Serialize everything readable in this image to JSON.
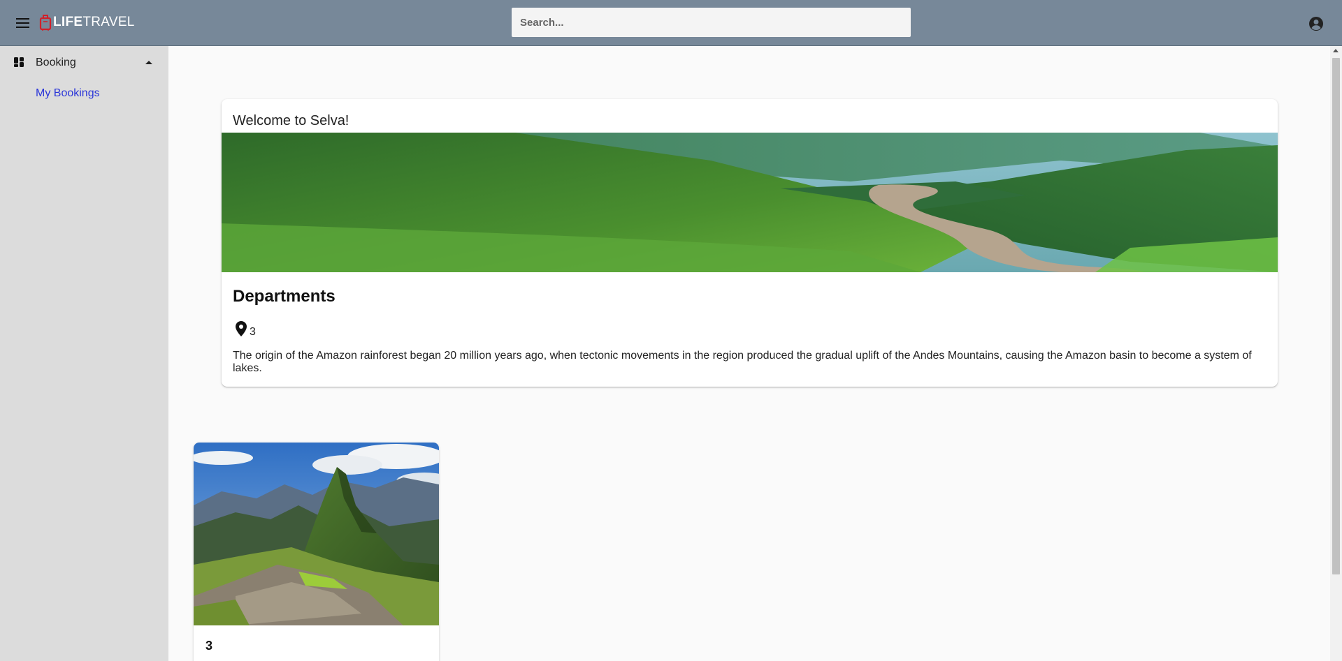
{
  "header": {
    "brand_life": "LIFE",
    "brand_travel": "TRAVEL",
    "search_placeholder": "Search...",
    "bar_color": "#778899"
  },
  "sidebar": {
    "group_label": "Booking",
    "items": [
      {
        "label": "My Bookings"
      }
    ],
    "link_color": "#2a35d8"
  },
  "main": {
    "welcome": {
      "greeting": "Welcome to Selva!",
      "section_title": "Departments",
      "count": "3",
      "description": "The origin of the Amazon rainforest began 20 million years ago, when tectonic movements in the region produced the gradual uplift of the Andes Mountains, causing the Amazon basin to become a system of lakes."
    },
    "cards": [
      {
        "title": "3"
      }
    ]
  }
}
